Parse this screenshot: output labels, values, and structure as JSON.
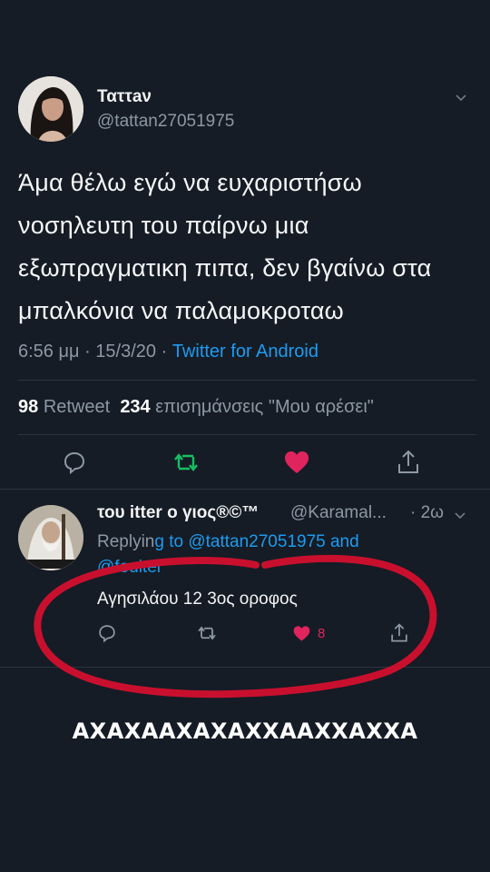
{
  "tweet": {
    "display_name": "Ταττaν",
    "handle": "@tattan27051975",
    "text": "Άμα θέλω εγώ να ευχαριστήσω νοσηλευτη του παίρνω μια εξωπραγματικη πιπα, δεν βγαίνω στα μπαλκόνια να παλαμοκροταω",
    "time": "6:56 μμ · 15/3/20 · ",
    "source_app": "Twitter for Android",
    "retweet_count": "98",
    "retweet_label": "Retweet",
    "like_count": "234",
    "like_label": "επισημάνσεις \"Μου αρέσει\"",
    "actions": [
      "reply-icon",
      "retweet-icon",
      "like-icon",
      "share-icon"
    ]
  },
  "reply": {
    "display_name": "του  itter ο γιος®©™",
    "handle": "@Karamal...",
    "time": "· 2ω",
    "replying_prefix": "Replyin",
    "replying_to": "g to @tattan27051975 and @fouiter",
    "text": "Αγησιλάου 12 3ος οροφος",
    "like_count": "8"
  },
  "caption": "ΑΧΑΧΑΑΧΑΧΑΧΧΑΑΧΧΑΧΧΑ",
  "colors": {
    "background": "#151c25",
    "accent_blue": "#1d9bf0",
    "like_red": "#e0245e",
    "retweet_green": "#17bf63",
    "annotation_red": "#c8102e"
  }
}
